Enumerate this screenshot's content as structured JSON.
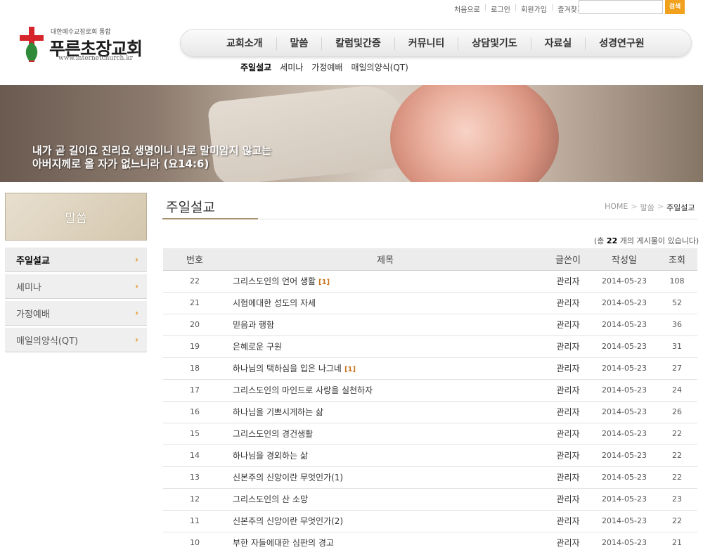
{
  "util": {
    "links": [
      "처음으로",
      "로그인",
      "회원가입",
      "즐겨찾기"
    ],
    "search_label": "검색"
  },
  "logo": {
    "subtitle": "대한예수교장로회 통합",
    "name": "푸른초장교회",
    "url": "www.internetchurch.kr"
  },
  "nav": {
    "items": [
      "교회소개",
      "말씀",
      "칼럼및간증",
      "커뮤니티",
      "상담및기도",
      "자료실",
      "성경연구원"
    ]
  },
  "subnav": {
    "items": [
      "주일설교",
      "세미나",
      "가정예배",
      "매일의양식(QT)"
    ],
    "active": 0
  },
  "banner": {
    "line1": "내가 곧 길이요 진리요 생명이니 나로 말미암지 않고는",
    "line2": "아버지께로 올 자가 없느니라 (요14:6)"
  },
  "side": {
    "title": "말씀",
    "items": [
      "주일설교",
      "세미나",
      "가정예배",
      "매일의양식(QT)"
    ],
    "arrow": "›"
  },
  "content": {
    "title": "주일설교",
    "breadcrumb": [
      "HOME",
      "말씀",
      "주일설교"
    ],
    "total_prefix": "(총",
    "total_count": "22",
    "total_suffix": "개의 게시물이 있습니다)"
  },
  "board": {
    "headers": [
      "번호",
      "제목",
      "글쓴이",
      "작성일",
      "조회"
    ],
    "rows": [
      {
        "num": "22",
        "title": "그리스도인의 언어 생활",
        "comments": "[1]",
        "writer": "관리자",
        "date": "2014-05-23",
        "hits": "108"
      },
      {
        "num": "21",
        "title": "시험에대한 성도의 자세",
        "comments": "",
        "writer": "관리자",
        "date": "2014-05-23",
        "hits": "52"
      },
      {
        "num": "20",
        "title": "믿음과 행함",
        "comments": "",
        "writer": "관리자",
        "date": "2014-05-23",
        "hits": "36"
      },
      {
        "num": "19",
        "title": "은혜로운 구원",
        "comments": "",
        "writer": "관리자",
        "date": "2014-05-23",
        "hits": "31"
      },
      {
        "num": "18",
        "title": "하나님의 택하심을 입은 나그네",
        "comments": "[1]",
        "writer": "관리자",
        "date": "2014-05-23",
        "hits": "27"
      },
      {
        "num": "17",
        "title": "그리스도인의 마인드로 사랑을 실천하자",
        "comments": "",
        "writer": "관리자",
        "date": "2014-05-23",
        "hits": "24"
      },
      {
        "num": "16",
        "title": "하나님을 기쁘시게하는 삶",
        "comments": "",
        "writer": "관리자",
        "date": "2014-05-23",
        "hits": "26"
      },
      {
        "num": "15",
        "title": "그리스도인의 경건생활",
        "comments": "",
        "writer": "관리자",
        "date": "2014-05-23",
        "hits": "22"
      },
      {
        "num": "14",
        "title": "하나님을 경외하는 삶",
        "comments": "",
        "writer": "관리자",
        "date": "2014-05-23",
        "hits": "22"
      },
      {
        "num": "13",
        "title": "신본주의 신앙이란 무엇인가(1)",
        "comments": "",
        "writer": "관리자",
        "date": "2014-05-23",
        "hits": "22"
      },
      {
        "num": "12",
        "title": "그리스도인의 산 소망",
        "comments": "",
        "writer": "관리자",
        "date": "2014-05-23",
        "hits": "23"
      },
      {
        "num": "11",
        "title": "신본주의 신앙이란 무엇인가(2)",
        "comments": "",
        "writer": "관리자",
        "date": "2014-05-23",
        "hits": "22"
      },
      {
        "num": "10",
        "title": "부한 자들에대한 심판의 경고",
        "comments": "",
        "writer": "관리자",
        "date": "2014-05-23",
        "hits": "21"
      }
    ]
  },
  "colors": {
    "accent": "#f2a11c",
    "comment": "#c8741d",
    "logo_red": "#d7262b",
    "logo_green": "#2f8a3a"
  }
}
